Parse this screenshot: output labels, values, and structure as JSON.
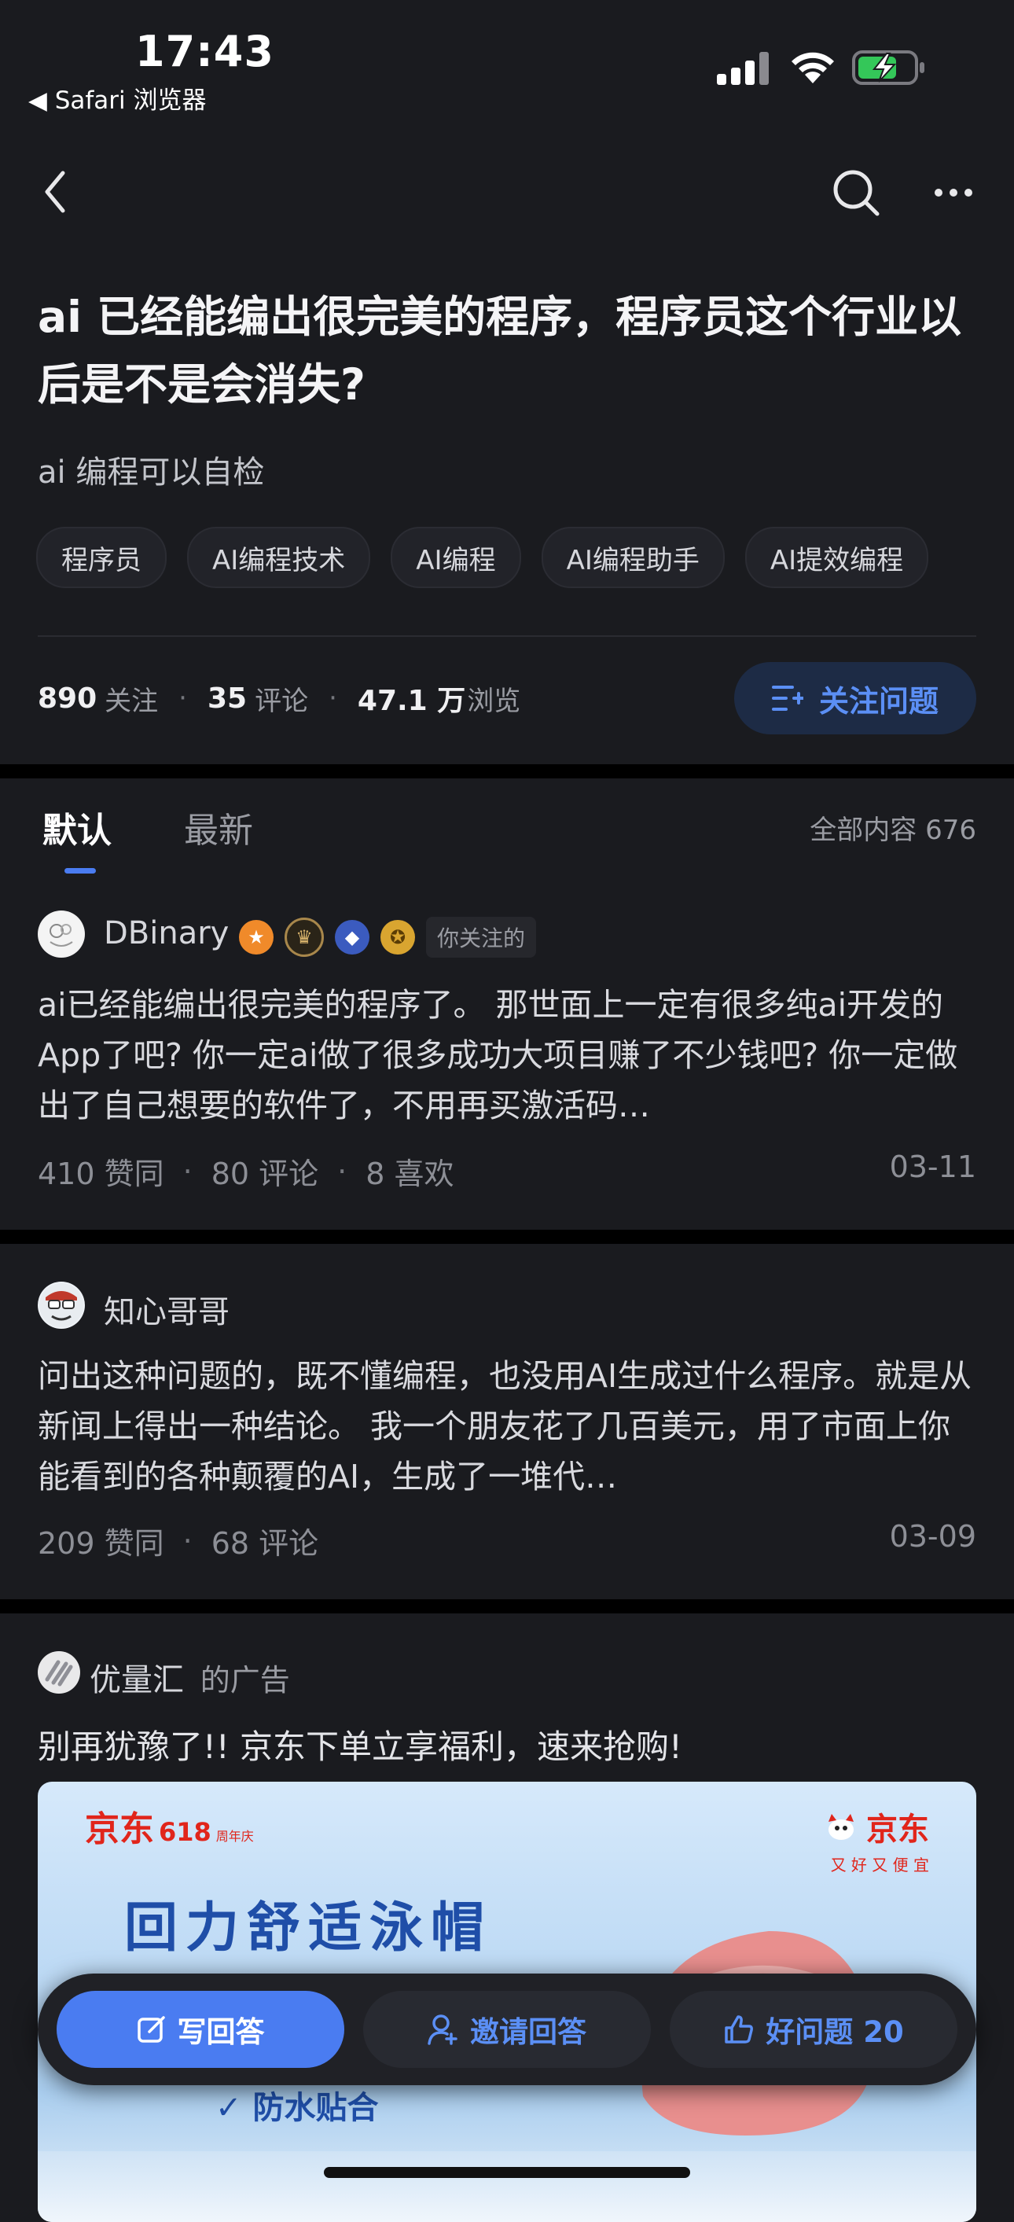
{
  "status_bar": {
    "time": "17:43",
    "back_app": "◀ Safari 浏览器"
  },
  "nav": {
    "back_icon": "chevron-left-icon",
    "search_icon": "search-icon",
    "more_icon": "more-icon"
  },
  "question": {
    "title": "ai 已经能编出很完美的程序，程序员这个行业以后是不是会消失?",
    "subtitle": "ai 编程可以自检",
    "tags": [
      "程序员",
      "AI编程技术",
      "AI编程",
      "AI编程助手",
      "AI提效编程"
    ],
    "followers_count": "890",
    "followers_label": "关注",
    "comments_count": "35",
    "comments_label": "评论",
    "views_count": "47.1 万",
    "views_label": "浏览",
    "follow_button": "关注问题"
  },
  "tabs": {
    "default": "默认",
    "latest": "最新",
    "all_content": "全部内容 676"
  },
  "answers": [
    {
      "author": "DBinary",
      "followed_tag": "你关注的",
      "text": "ai已经能编出很完美的程序了。 那世面上一定有很多纯ai开发的App了吧? 你一定ai做了很多成功大项目赚了不少钱吧? 你一定做出了自己想要的软件了，不用再买激活码…",
      "agree": "410 赞同",
      "comments": "80 评论",
      "likes": "8 喜欢",
      "date": "03-11"
    },
    {
      "author": "知心哥哥",
      "text": "问出这种问题的，既不懂编程，也没用AI生成过什么程序。就是从新闻上得出一种结论。 我一个朋友花了几百美元，用了市面上你能看到的各种颠覆的AI，生成了一堆代…",
      "agree": "209 赞同",
      "comments": "68 评论",
      "date": "03-09"
    }
  ],
  "ad": {
    "advertiser": "优量汇",
    "ad_suffix": "的广告",
    "headline": "别再犹豫了!!  京东下单立享福利，速来抢购!",
    "banner": {
      "brand_left": "京东",
      "brand_618": "618",
      "anniversary": "周年庆",
      "brand_right": "京东",
      "slogan": "又 好 又 便 宜",
      "product": "回力舒适泳帽",
      "feature": "✓ 防水贴合"
    }
  },
  "bottom_bar": {
    "write_answer": "写回答",
    "invite_answer": "邀请回答",
    "good_question": "好问题 20"
  },
  "colors": {
    "accent": "#4a7cf1",
    "background": "#1a1b1f",
    "separator": "#000000"
  }
}
